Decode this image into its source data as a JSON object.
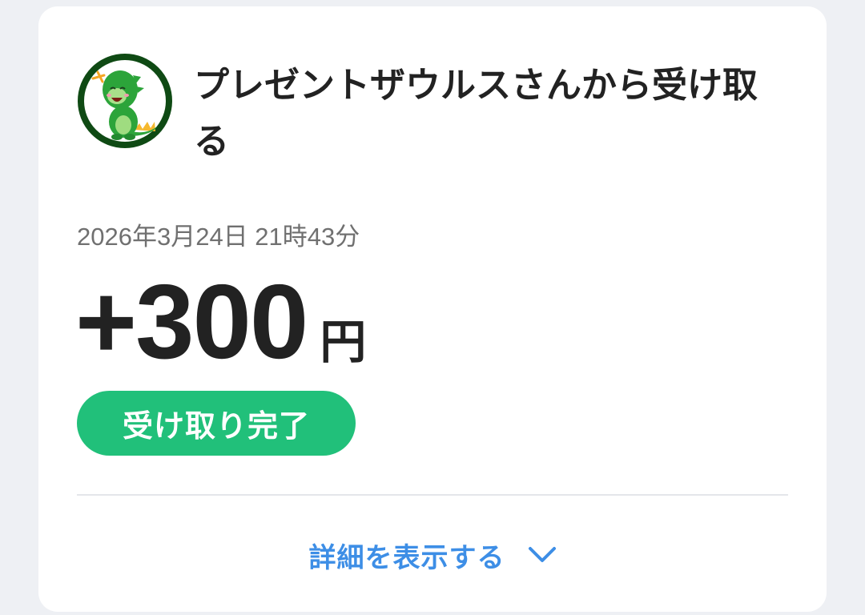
{
  "transaction": {
    "title": "プレゼントザウルスさんから受け取る",
    "datetime": "2026年3月24日 21時43分",
    "amount": "+300",
    "currency_unit": "円",
    "status_badge": "受け取り完了",
    "details_label": "詳細を表示する"
  },
  "icons": {
    "avatar": "green-dinosaur-avatar",
    "expand": "chevron-down-icon"
  },
  "colors": {
    "background": "#eef0f4",
    "card": "#ffffff",
    "badge": "#21c07a",
    "link": "#3d8ee6",
    "avatar_ring": "#0f4a14",
    "dinosaur": "#2ca43a"
  }
}
